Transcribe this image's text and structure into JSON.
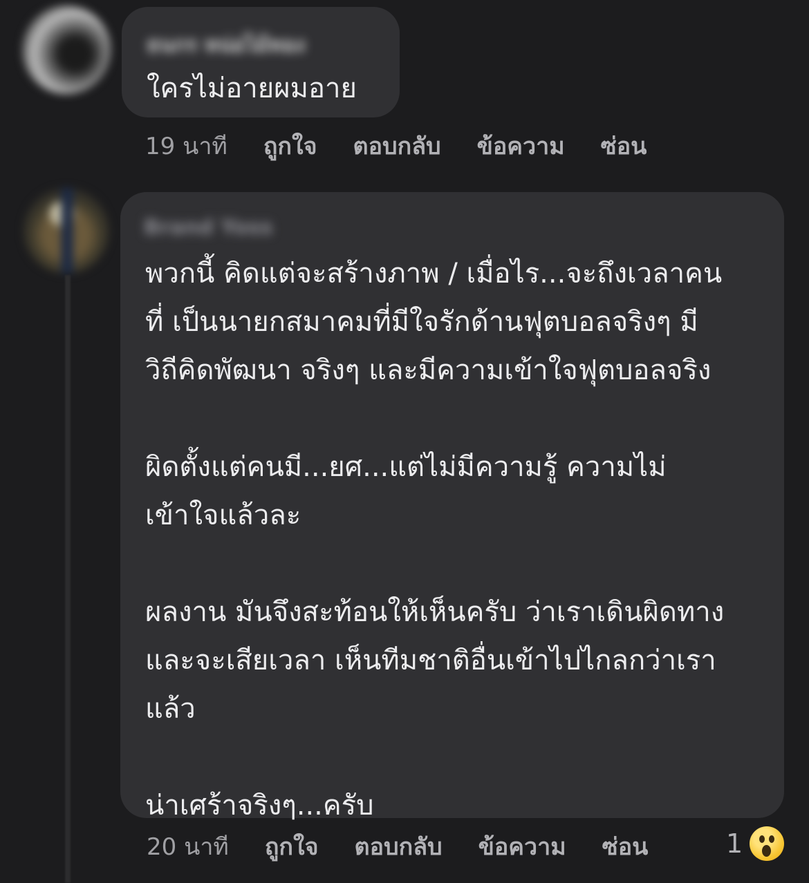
{
  "comments": [
    {
      "author": "ธนกร หน่อไม้ทอง",
      "lines": [
        "ใครไม่อายผมอาย"
      ],
      "timestamp": "19 นาที",
      "actions": {
        "like": "ถูกใจ",
        "reply": "ตอบกลับ",
        "message": "ข้อความ",
        "hide": "ซ่อน"
      }
    },
    {
      "author": "Brand Yoss",
      "lines": [
        "พวกนี้ คิดแต่จะสร้างภาพ / เมื่อไร...จะถึงเวลาคน",
        "ที่ เป็นนายกสมาคมที่มีใจรักด้านฟุตบอลจริงๆ มี",
        "วิถีคิดพัฒนา จริงๆ และมีความเข้าใจฟุตบอลจริง",
        "",
        "ผิดตั้งแต่คนมี...ยศ...แต่ไม่มีความรู้ ความไม่",
        "เข้าใจแล้วละ",
        "",
        "ผลงาน มันจึงสะท้อนให้เห็นครับ ว่าเราเดินผิดทาง",
        "และจะเสียเวลา เห็นทีมชาติอื่นเข้าไปไกลกว่าเรา",
        "แล้ว",
        "",
        "น่าเศร้าจริงๆ...ครับ"
      ],
      "timestamp": "20 นาที",
      "actions": {
        "like": "ถูกใจ",
        "reply": "ตอบกลับ",
        "message": "ข้อความ",
        "hide": "ซ่อน"
      },
      "reaction": {
        "count": "1",
        "icon": "wow-emoji-icon",
        "color": "#f7c531"
      }
    }
  ],
  "colors": {
    "background": "#1c1c1e",
    "bubble": "#303033",
    "text": "#ececee",
    "meta": "#a9a9ad"
  }
}
